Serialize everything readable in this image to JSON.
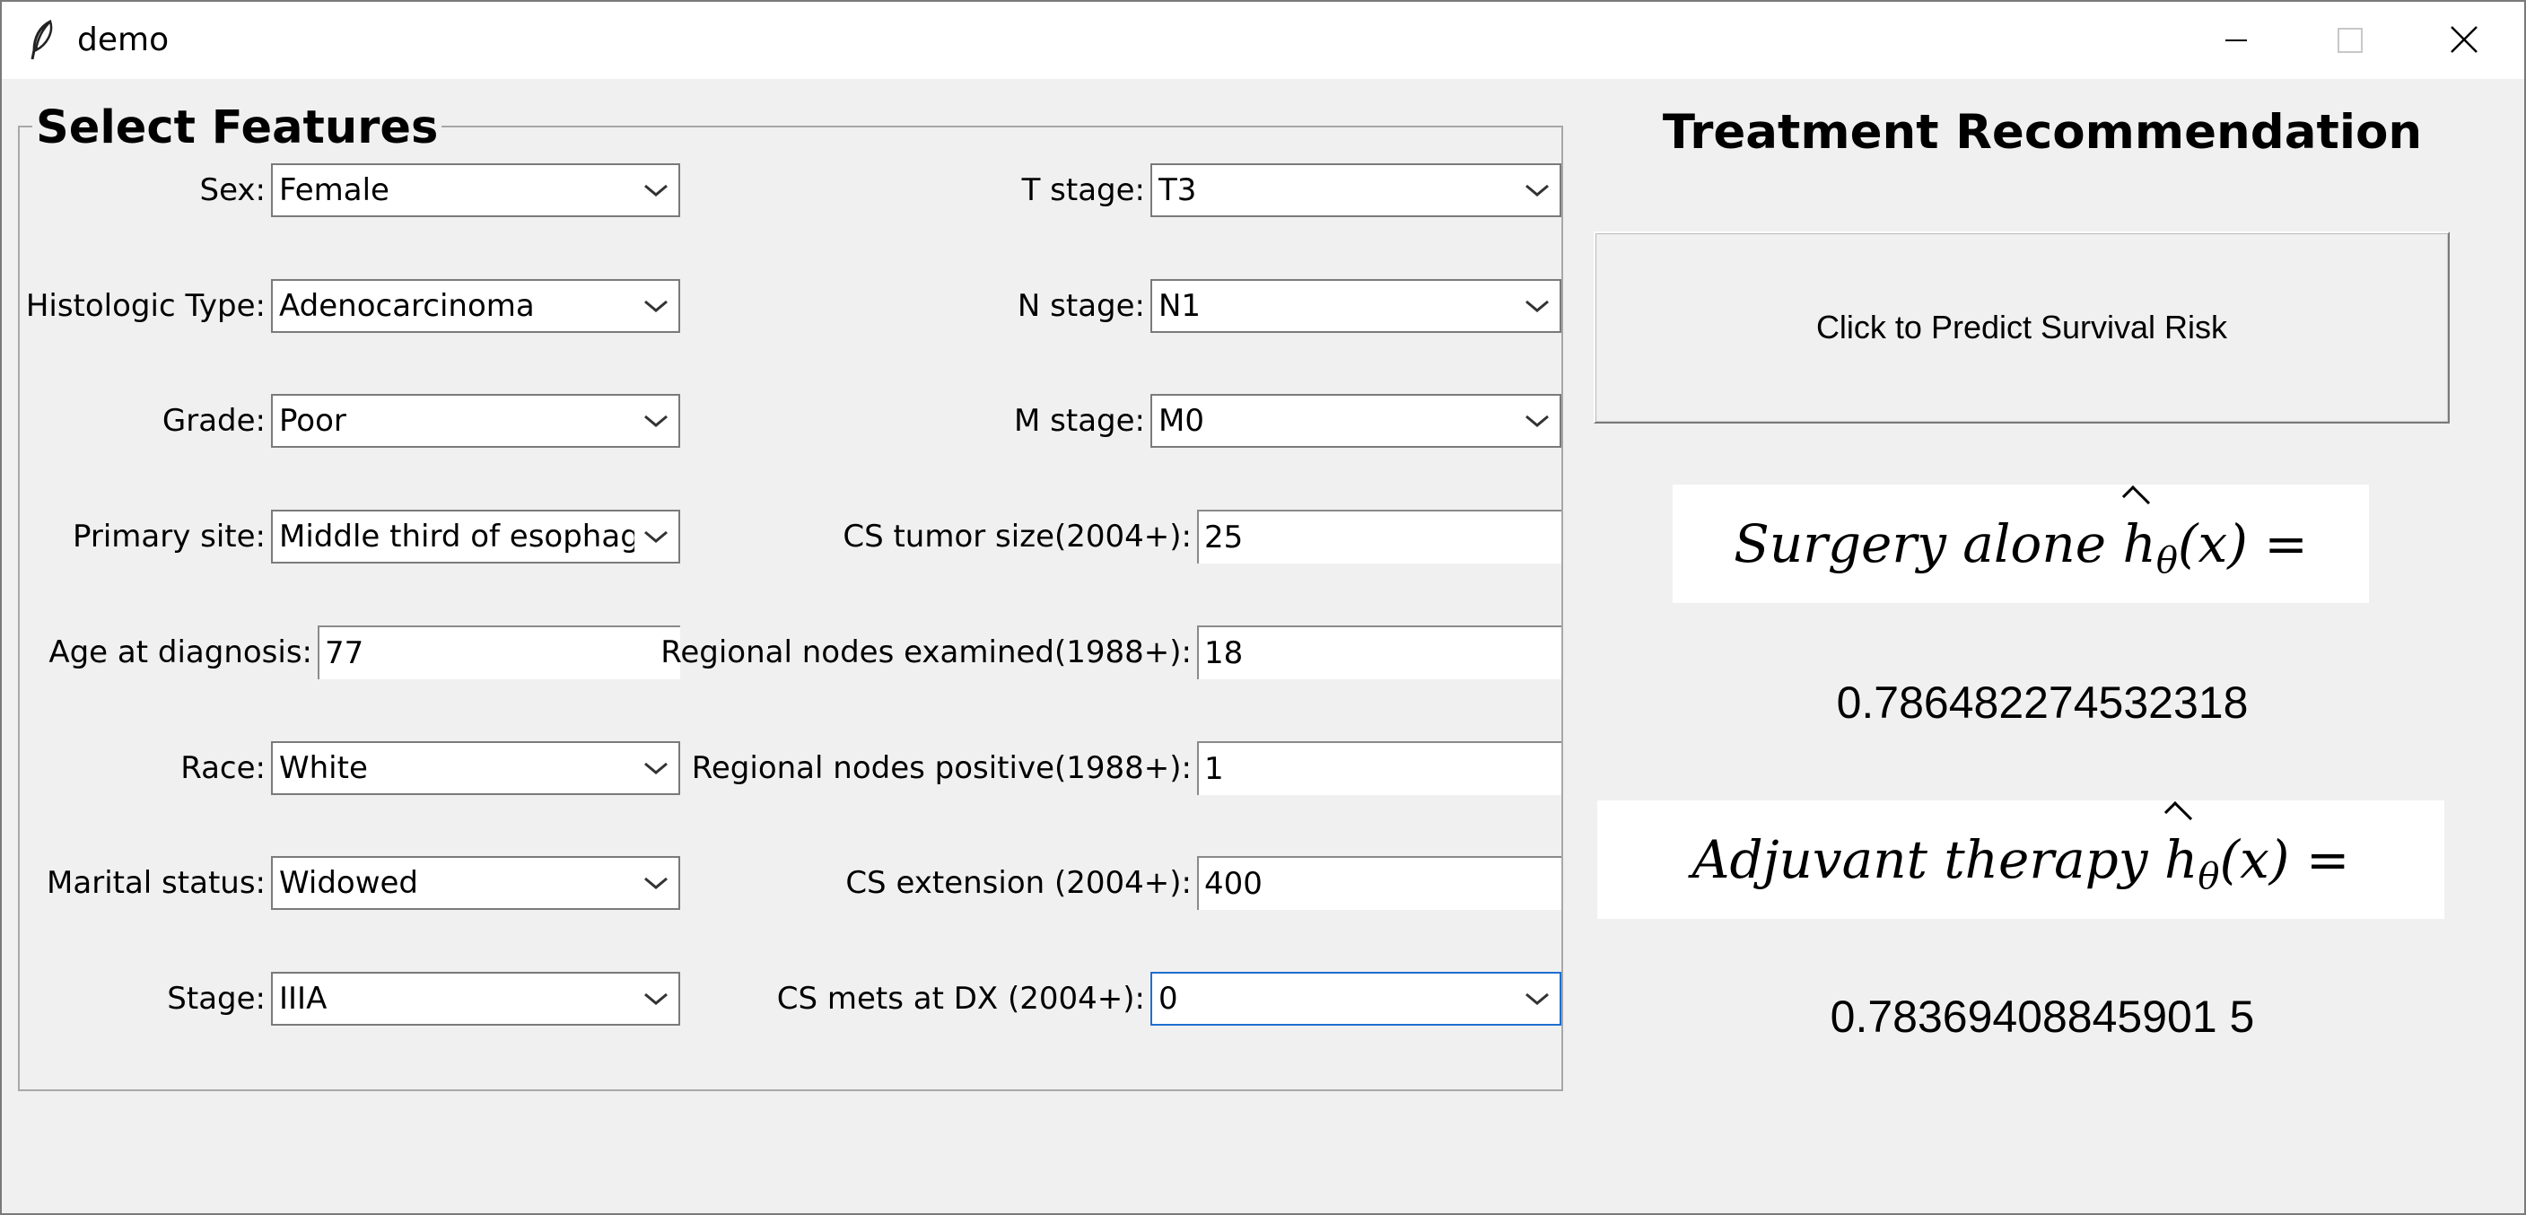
{
  "window": {
    "title": "demo",
    "icon": "feather-icon"
  },
  "features": {
    "title": "Select Features",
    "left": [
      {
        "label": "Sex:",
        "type": "combo",
        "value": "Female"
      },
      {
        "label": "Histologic Type:",
        "type": "combo",
        "value": "Adenocarcinoma"
      },
      {
        "label": "Grade:",
        "type": "combo",
        "value": "Poor"
      },
      {
        "label": "Primary site:",
        "type": "combo",
        "value": "Middle third of esophagus"
      },
      {
        "label": "Age at diagnosis:",
        "type": "entry",
        "value": "77"
      },
      {
        "label": "Race:",
        "type": "combo",
        "value": "White"
      },
      {
        "label": "Marital status:",
        "type": "combo",
        "value": "Widowed"
      },
      {
        "label": "Stage:",
        "type": "combo",
        "value": "IIIA"
      }
    ],
    "right": [
      {
        "label": "T stage:",
        "type": "combo",
        "value": "T3"
      },
      {
        "label": "N stage:",
        "type": "combo",
        "value": "N1"
      },
      {
        "label": "M stage:",
        "type": "combo",
        "value": "M0"
      },
      {
        "label": "CS tumor size(2004+):",
        "type": "entry",
        "value": "25"
      },
      {
        "label": "Regional nodes examined(1988+):",
        "type": "entry",
        "value": "18"
      },
      {
        "label": "Regional nodes positive(1988+):",
        "type": "entry",
        "value": "1"
      },
      {
        "label": "CS extension (2004+):",
        "type": "entry",
        "value": "400"
      },
      {
        "label": "CS mets at DX (2004+):",
        "type": "combo",
        "value": "0"
      }
    ]
  },
  "recommendation": {
    "title": "Treatment Recommendation",
    "predict_button": "Click to Predict Survival Risk",
    "surgery_label": "Surgery alone",
    "adjuvant_label": "Adjuvant therapy",
    "formula_h": "h",
    "formula_sub": "θ",
    "formula_rest": "(x) =",
    "surgery_value": "0.786482274532318",
    "adjuvant_value": "0.78369408845901 5"
  }
}
